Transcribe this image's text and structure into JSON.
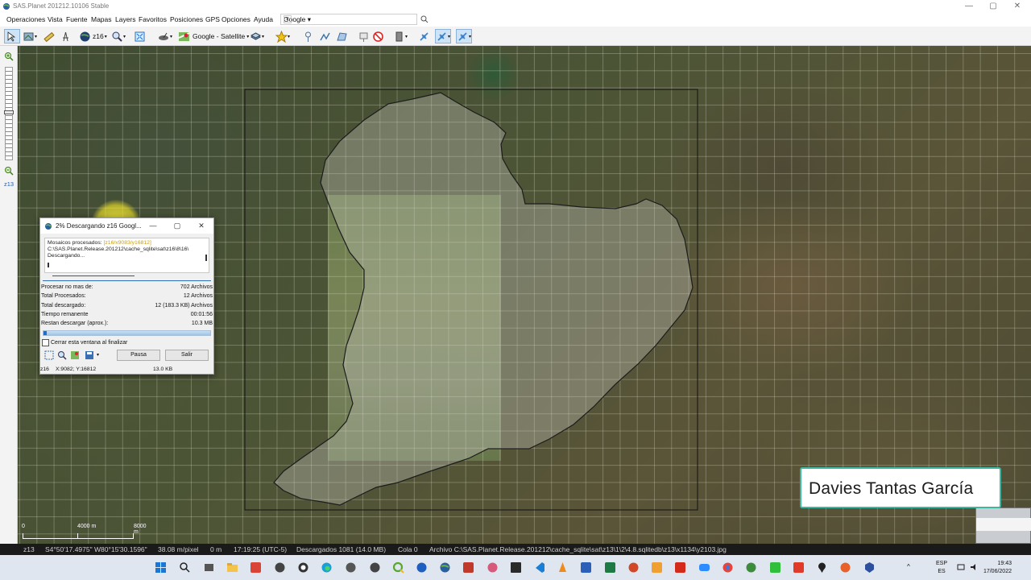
{
  "window": {
    "title": "SAS.Planet 201212.10106 Stable",
    "controls": [
      "—",
      "▢",
      "✕"
    ]
  },
  "menu": {
    "items": [
      "Operaciones",
      "Vista",
      "Fuente",
      "Mapas",
      "Layers",
      "Favoritos",
      "Posiciones",
      "GPS",
      "Opciones",
      "Ayuda"
    ],
    "search_engine": "Google",
    "search_value": ""
  },
  "toolbar": {
    "zoom_label": "z16",
    "map_source_label": "Google - Satellite"
  },
  "left_toolbar": {
    "zoom_level_label": "z13"
  },
  "dialog": {
    "title": "2% Descargando z16 Googl...",
    "log_lines": {
      "line1_prefix": "Mosaicos procesados: ",
      "line1_highlight": "[z16/x9083/y16812]",
      "line2": "C:\\SAS.Planet.Release.201212\\cache_sqlite\\sat\\z16\\8\\16\\",
      "line3": "Descargando..."
    },
    "stats": [
      {
        "label": "Procesar no mas de:",
        "value": "702 Archivos"
      },
      {
        "label": "Total Procesados:",
        "value": "12 Archivos"
      },
      {
        "label": "Total descargado:",
        "value": "12 (183.3 KB) Archivos"
      },
      {
        "label": "Tiempo remanente",
        "value": "00:01:56"
      },
      {
        "label": "Restan descargar (aprox.):",
        "value": "10.3 MB"
      }
    ],
    "progress": 0.02,
    "close_on_finish_label": "Cerrar esta ventana al finalizar",
    "pause_label": "Pausa",
    "exit_label": "Salir",
    "status_zoom": "z16",
    "status_coords": "X:9082; Y:16812",
    "status_size": "13.0 KB"
  },
  "scale": {
    "mid_label": "4000 m",
    "end_label": "8000 m",
    "start_label": "0"
  },
  "overlay_name": "Davies Tantas García",
  "statusbar": {
    "zoom": "z13",
    "coords": "S4°50'17.4975\" W80°15'30.1596\"",
    "resolution": "38.08 m/pixel",
    "distance": "0 m",
    "time": "17:19:25 (UTC-5)",
    "downloaded": "Descargados 1081 (14.0 MB)",
    "queue": "Cola 0",
    "file": "Archivo C:\\SAS.Planet.Release.201212\\cache_sqlite\\sat\\z13\\1\\2\\4.8.sqlitedb\\z13\\x1134\\y2103.jpg"
  },
  "taskbar": {
    "lang_top": "ESP",
    "lang_bottom": "ES",
    "time": "19:43",
    "date": "17/06/2022"
  },
  "colors": {
    "accent": "#1b6fd1",
    "polygon_fill": "rgba(200,200,195,0.35)",
    "nameplate_border": "#3cb8a0"
  }
}
